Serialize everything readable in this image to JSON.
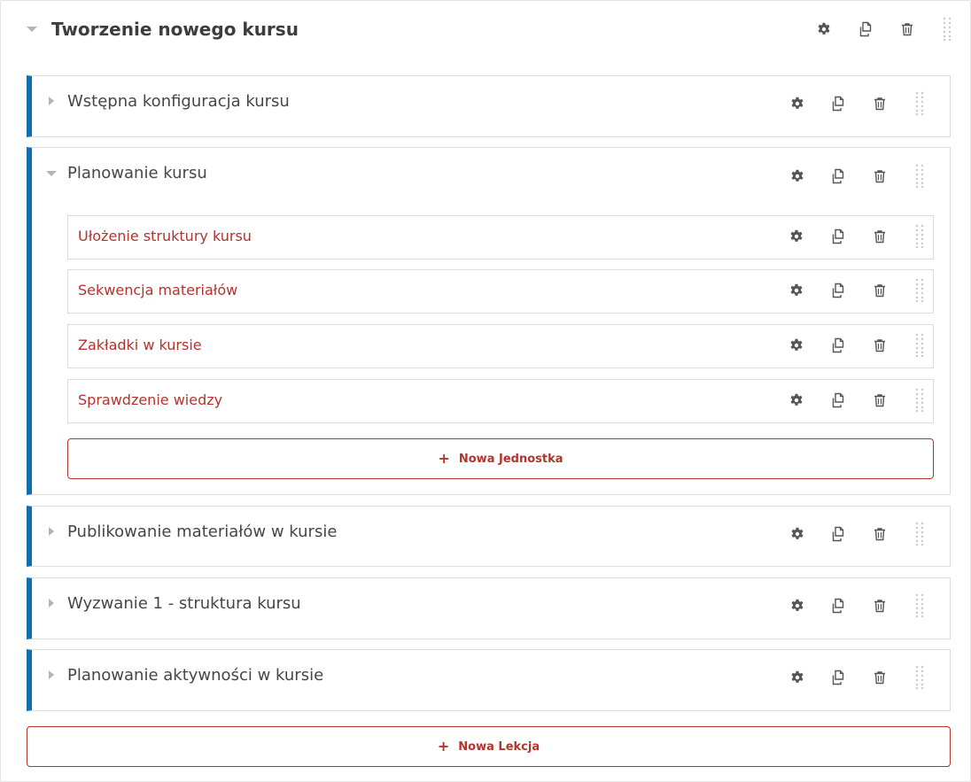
{
  "course": {
    "title": "Tworzenie nowego kursu",
    "expanded": true
  },
  "lessons": [
    {
      "title": "Wstępna konfiguracja kursu",
      "expanded": false
    },
    {
      "title": "Planowanie kursu",
      "expanded": true,
      "units": [
        {
          "title": "Ułożenie struktury kursu"
        },
        {
          "title": "Sekwencja materiałów"
        },
        {
          "title": "Zakładki w kursie"
        },
        {
          "title": "Sprawdzenie wiedzy"
        }
      ],
      "add_unit_label": "Nowa Jednostka"
    },
    {
      "title": "Publikowanie materiałów w kursie",
      "expanded": false
    },
    {
      "title": "Wyzwanie 1 - struktura kursu",
      "expanded": false
    },
    {
      "title": "Planowanie aktywności w kursie",
      "expanded": false
    }
  ],
  "add_lesson_label": "Nowa Lekcja",
  "colors": {
    "accent_blue": "#0f6fb3",
    "link_red": "#b3332d",
    "icon_gray": "#555555",
    "caret_gray": "#b4b4b4"
  },
  "icons": [
    "gear-icon",
    "copy-icon",
    "trash-icon",
    "drag-handle-icon",
    "caret-down-icon",
    "caret-right-icon",
    "plus-icon"
  ]
}
